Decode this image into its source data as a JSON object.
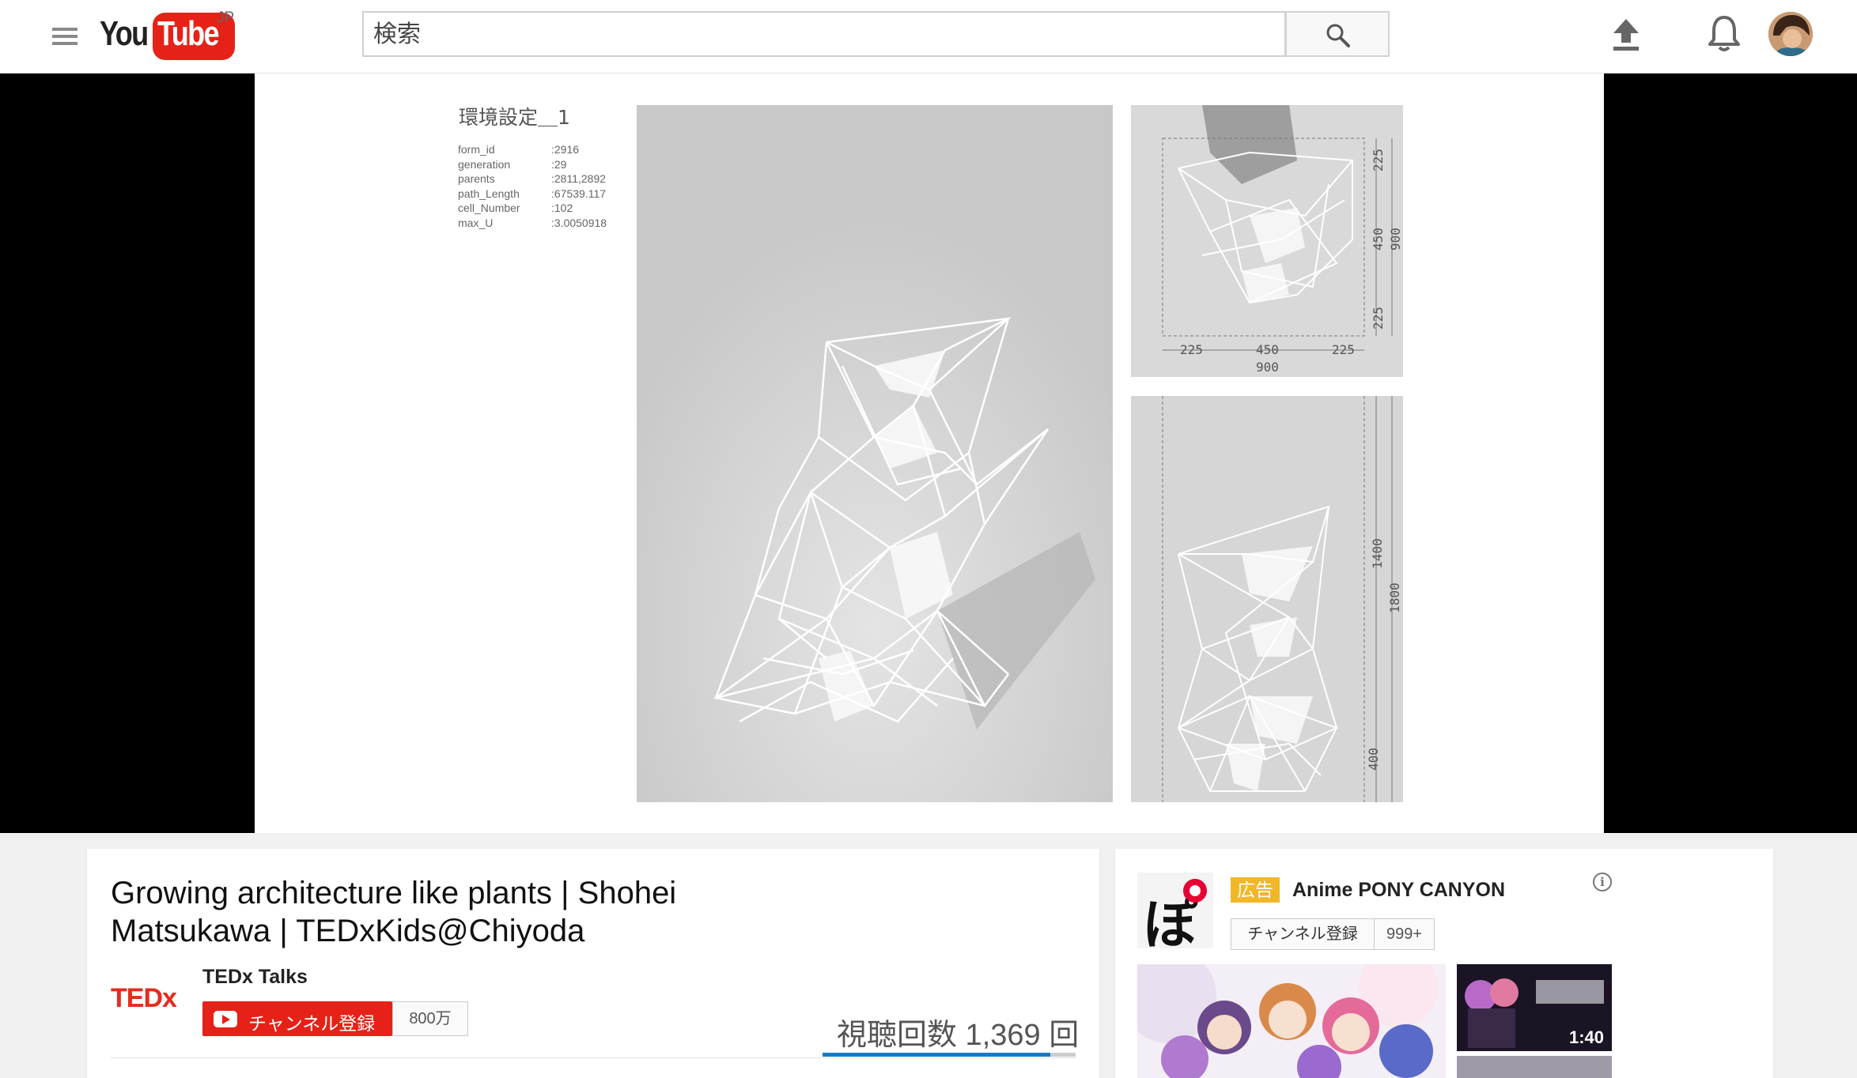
{
  "masthead": {
    "logo_you": "You",
    "logo_tube": "Tube",
    "logo_region": "JP",
    "search_placeholder": "検索",
    "icons": [
      "menu-icon",
      "search-icon",
      "upload-icon",
      "bell-icon",
      "avatar"
    ]
  },
  "slide": {
    "title": "環境設定＿1",
    "params": [
      {
        "key": "form_id",
        "value": ":2916"
      },
      {
        "key": "generation",
        "value": ":29"
      },
      {
        "key": "parents",
        "value": ":2811,2892"
      },
      {
        "key": "path_Length",
        "value": ":67539.117"
      },
      {
        "key": "cell_Number",
        "value": ":102"
      },
      {
        "key": "max_U",
        "value": ":3.0050918"
      }
    ],
    "top_view_dims": {
      "h_left": "225",
      "h_mid": "450",
      "h_right": "225",
      "h_total": "900",
      "v_top": "225",
      "v_mid": "450",
      "v_bottom": "225",
      "v_total": "900"
    },
    "side_view_dims": {
      "v_upper": "1400",
      "v_lower": "400",
      "v_total": "1800"
    }
  },
  "video": {
    "title": "Growing architecture like plants | Shohei Matsukawa | TEDxKids@Chiyoda",
    "channel_logo": "TEDx",
    "channel_name": "TEDx Talks",
    "subscribe_label": "チャンネル登録",
    "subscriber_count": "800万",
    "view_count": "視聴回数 1,369 回",
    "like_ratio": 0.9
  },
  "ad": {
    "logo_text": "ぽ",
    "badge": "広告",
    "channel_name": "Anime PONY CANYON",
    "info_icon": "i",
    "subscribe_label": "チャンネル登録",
    "subscriber_count": "999+",
    "side_thumb_duration": "1:40"
  },
  "colors": {
    "brand_red": "#e62117",
    "ted_red": "#e62b1e",
    "ad_badge": "#f2b728",
    "like_bar": "#167ac6"
  }
}
